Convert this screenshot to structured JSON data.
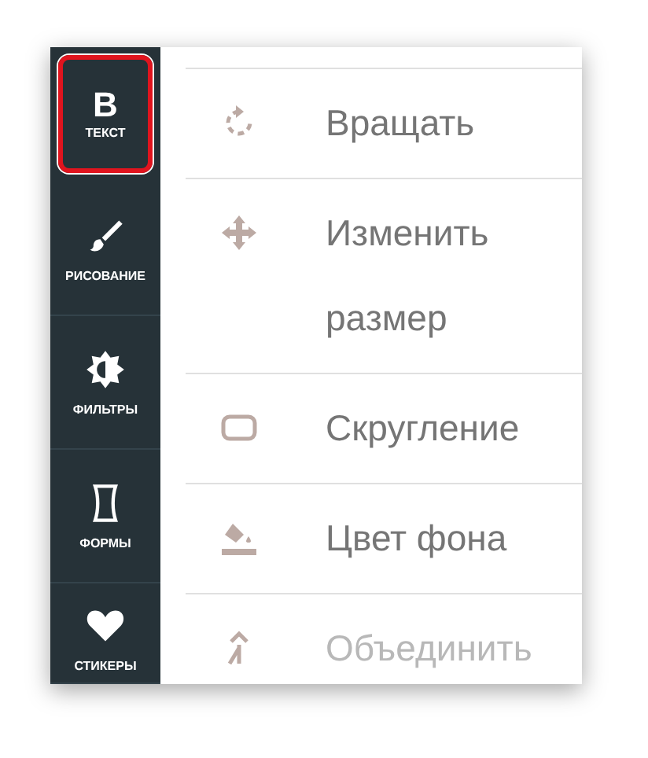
{
  "sidebar": {
    "items": [
      {
        "kind": "text",
        "glyph": "B",
        "label": "ТЕКСТ",
        "selected": true
      },
      {
        "kind": "brush",
        "label": "РИСОВАНИЕ",
        "selected": false
      },
      {
        "kind": "filter",
        "label": "ФИЛЬТРЫ",
        "selected": false
      },
      {
        "kind": "shape",
        "label": "ФОРМЫ",
        "selected": false
      },
      {
        "kind": "heart",
        "label": "СТИКЕРЫ",
        "selected": false
      }
    ]
  },
  "tools": [
    {
      "kind": "rotate",
      "label": "Вращать",
      "disabled": false
    },
    {
      "kind": "resize",
      "label": "Изменить размер",
      "disabled": false
    },
    {
      "kind": "round",
      "label": "Скругление",
      "disabled": false
    },
    {
      "kind": "fill",
      "label": "Цвет фона",
      "disabled": false
    },
    {
      "kind": "merge",
      "label": "Объединить",
      "disabled": true
    }
  ]
}
